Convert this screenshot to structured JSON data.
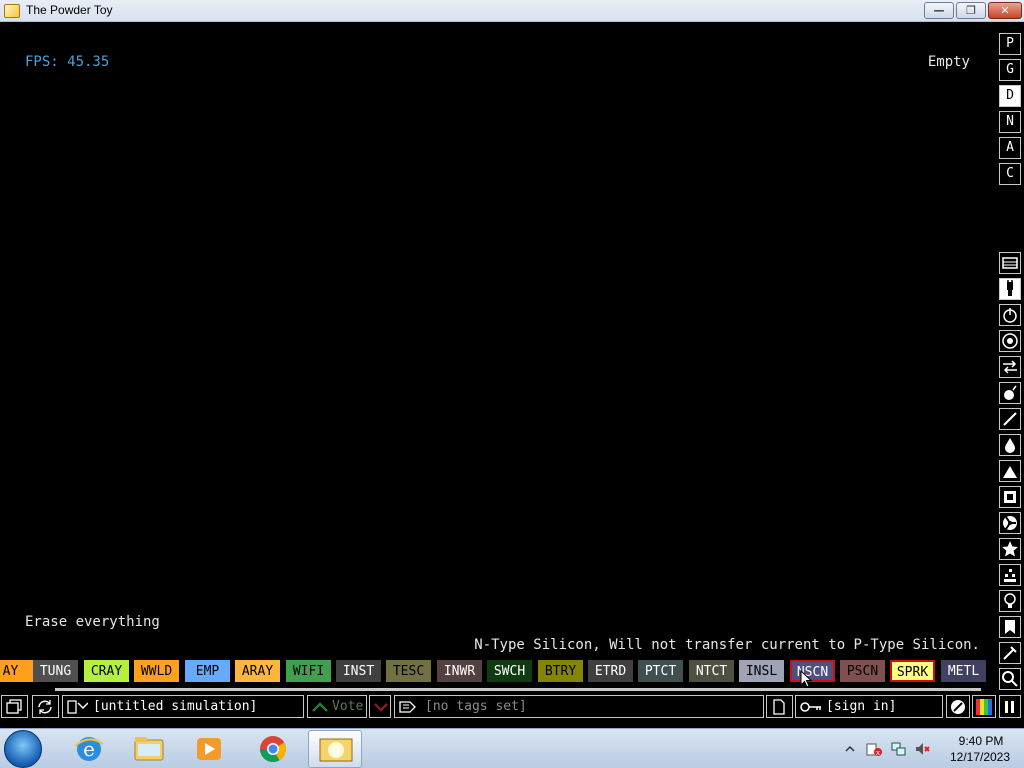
{
  "window": {
    "title": "The Powder Toy"
  },
  "hud": {
    "fps": "FPS: 45.35",
    "hover_info": "Empty",
    "tooltip": "Erase everything",
    "element_description": "N-Type Silicon, Will not transfer current to P-Type Silicon."
  },
  "mode_buttons": [
    "P",
    "G",
    "D",
    "N",
    "A",
    "C"
  ],
  "active_mode": "D",
  "categories": [
    "sim-options-icon",
    "powered-icon",
    "force-icon",
    "sensor-icon",
    "lamp-icon",
    "explosive-icon",
    "gas-icon",
    "liquid-icon",
    "powder-icon",
    "solid-icon",
    "radioactive-icon",
    "special-icon",
    "life-icon",
    "tools-icon",
    "favorites-icon",
    "deco-icon",
    "search-icon"
  ],
  "elements": [
    {
      "label": "AY",
      "bg": "#ff9f1c",
      "fg": "#000000"
    },
    {
      "label": "TUNG",
      "bg": "#505050",
      "fg": "#ffffff"
    },
    {
      "label": "CRAY",
      "bg": "#b5f03c",
      "fg": "#000000"
    },
    {
      "label": "WWLD",
      "bg": "#ffa01f",
      "fg": "#000000"
    },
    {
      "label": "EMP",
      "bg": "#66aaff",
      "fg": "#000000"
    },
    {
      "label": "ARAY",
      "bg": "#ffb63c",
      "fg": "#000000"
    },
    {
      "label": "WIFI",
      "bg": "#40a050",
      "fg": "#000000"
    },
    {
      "label": "INST",
      "bg": "#404040",
      "fg": "#ffffff"
    },
    {
      "label": "TESC",
      "bg": "#707040",
      "fg": "#000000"
    },
    {
      "label": "INWR",
      "bg": "#544141",
      "fg": "#ffffff"
    },
    {
      "label": "SWCH",
      "bg": "#103b11",
      "fg": "#ffffff"
    },
    {
      "label": "BTRY",
      "bg": "#858505",
      "fg": "#000000"
    },
    {
      "label": "ETRD",
      "bg": "#404040",
      "fg": "#ffffff"
    },
    {
      "label": "PTCT",
      "bg": "#405050",
      "fg": "#ffffff"
    },
    {
      "label": "NTCT",
      "bg": "#505040",
      "fg": "#ffffff"
    },
    {
      "label": "INSL",
      "bg": "#9ea3b6",
      "fg": "#000000"
    },
    {
      "label": "NSCN",
      "bg": "#505080",
      "fg": "#ffffff",
      "selected": true
    },
    {
      "label": "PSCN",
      "bg": "#805050",
      "fg": "#000000"
    },
    {
      "label": "SPRK",
      "bg": "#ffff80",
      "fg": "#000000",
      "selected": true
    },
    {
      "label": "METL",
      "bg": "#404060",
      "fg": "#ffffff"
    }
  ],
  "bottom": {
    "save_name": "[untitled simulation]",
    "vote_label": "Vote",
    "tags": "[no tags set]",
    "sign_in": "[sign in]"
  },
  "taskbar": {
    "time": "9:40 PM",
    "date": "12/17/2023",
    "apps": [
      "internet-explorer-icon",
      "file-explorer-icon",
      "media-player-icon",
      "chrome-icon",
      "powder-toy-icon"
    ]
  }
}
